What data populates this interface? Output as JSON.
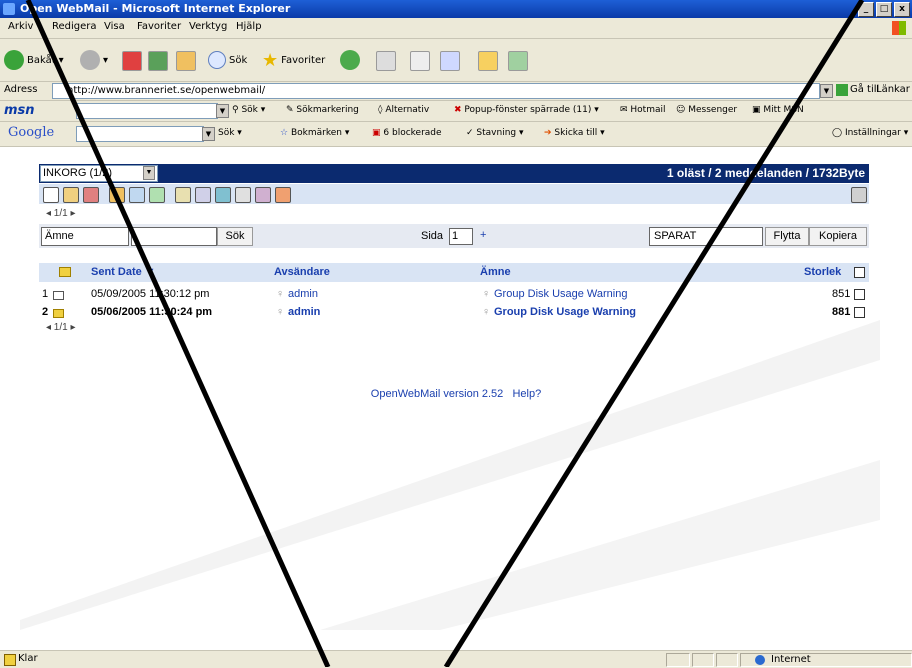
{
  "window": {
    "title": "Open WebMail - Microsoft Internet Explorer",
    "controls": [
      "_",
      "□",
      "x"
    ]
  },
  "menu": [
    "Arkiv",
    "Redigera",
    "Visa",
    "Favoriter",
    "Verktyg",
    "Hjälp"
  ],
  "toolbar": {
    "back": "Bakåt",
    "search": "Sök",
    "favorites": "Favoriter"
  },
  "address": {
    "label": "Adress",
    "url": "http://www.branneriet.se/openwebmail/",
    "go": "Gå till",
    "links": "Länkar"
  },
  "msn": {
    "logo": "msn",
    "search": "Sök",
    "highlight": "Sökmarkering",
    "options": "Alternativ",
    "popup": "Popup-fönster spärrade (11)",
    "hotmail": "Hotmail",
    "messenger": "Messenger",
    "mymsn": "Mitt MSN"
  },
  "google": {
    "logo": "Google",
    "search": "Sök",
    "bookmarks": "Bokmärken",
    "blocked": "6 blockerade",
    "spelling": "Stavning",
    "sendto": "Skicka till",
    "settings": "Inställningar"
  },
  "mail": {
    "folder": "INKORG (1/2)",
    "summary": "1 oläst / 2 meddelanden / 1732Byte",
    "pager": "◂ 1/1 ▸",
    "search_field": "Ämne",
    "search_value": "",
    "search_button": "Sök",
    "page_label": "Sida",
    "page_value": "1",
    "page_plus": "+",
    "destination": "SPARAT",
    "move_button": "Flytta",
    "copy_button": "Kopiera",
    "columns": {
      "date": "Sent Date ▼",
      "from": "Avsändare",
      "subject": "Ämne",
      "size": "Storlek"
    },
    "messages": [
      {
        "num": "1",
        "date": "05/09/2005 11:30:12 pm",
        "from": "admin",
        "subject": "Group Disk Usage Warning",
        "size": "851",
        "unread": false
      },
      {
        "num": "2",
        "date": "05/06/2005 11:30:24 pm",
        "from": "admin",
        "subject": "Group Disk Usage Warning",
        "size": "881",
        "unread": true
      }
    ],
    "footer_version": "OpenWebMail version 2.52",
    "footer_help": "Help?"
  },
  "status": {
    "left": "Klar",
    "zone": "Internet"
  },
  "colors": {
    "header_navy": "#0b2a6f",
    "link_blue": "#1a3fae",
    "icon_bar": "#d9e4f4"
  }
}
